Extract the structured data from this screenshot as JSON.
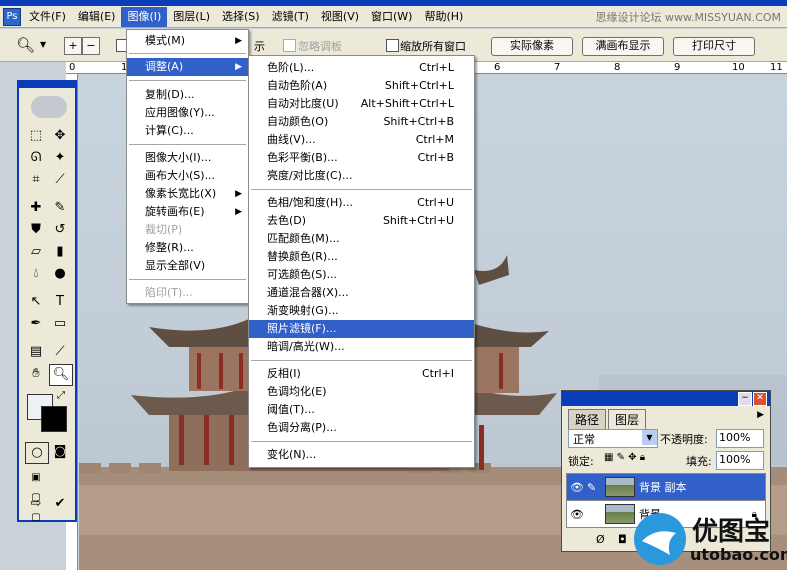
{
  "menubar": {
    "items": [
      "文件(F)",
      "编辑(E)",
      "图像(I)",
      "图层(L)",
      "选择(S)",
      "滤镜(T)",
      "视图(V)",
      "窗口(W)",
      "帮助(H)"
    ],
    "watermark": "思缘设计论坛 www.MISSYUAN.COM"
  },
  "options": {
    "ignore_palettes": "忽略调板",
    "resize_all_windows": "缩放所有窗口",
    "btn_actual_pixels": "实际像素",
    "btn_fit_screen": "满画布显示",
    "btn_print_size": "打印尺寸",
    "partial_label": "示"
  },
  "ruler": {
    "ticks": [
      "0",
      "1",
      "6",
      "7",
      "8",
      "9",
      "10",
      "11"
    ]
  },
  "image_menu": {
    "items": [
      {
        "label": "模式(M)",
        "submenu": true
      },
      {
        "label": "调整(A)",
        "submenu": true
      },
      {
        "label": "复制(D)..."
      },
      {
        "label": "应用图像(Y)..."
      },
      {
        "label": "计算(C)..."
      },
      {
        "label": "图像大小(I)..."
      },
      {
        "label": "画布大小(S)..."
      },
      {
        "label": "像素长宽比(X)",
        "submenu": true
      },
      {
        "label": "旋转画布(E)",
        "submenu": true
      },
      {
        "label": "裁切(P)",
        "disabled": true
      },
      {
        "label": "修整(R)..."
      },
      {
        "label": "显示全部(V)"
      },
      {
        "label": "陷印(T)...",
        "disabled": true
      }
    ]
  },
  "adjust_menu": {
    "items": [
      {
        "label": "色阶(L)...",
        "shortcut": "Ctrl+L"
      },
      {
        "label": "自动色阶(A)",
        "shortcut": "Shift+Ctrl+L"
      },
      {
        "label": "自动对比度(U)",
        "shortcut": "Alt+Shift+Ctrl+L"
      },
      {
        "label": "自动颜色(O)",
        "shortcut": "Shift+Ctrl+B"
      },
      {
        "label": "曲线(V)...",
        "shortcut": "Ctrl+M"
      },
      {
        "label": "色彩平衡(B)...",
        "shortcut": "Ctrl+B"
      },
      {
        "label": "亮度/对比度(C)..."
      },
      {
        "label": "色相/饱和度(H)...",
        "shortcut": "Ctrl+U"
      },
      {
        "label": "去色(D)",
        "shortcut": "Shift+Ctrl+U"
      },
      {
        "label": "匹配颜色(M)..."
      },
      {
        "label": "替换颜色(R)..."
      },
      {
        "label": "可选颜色(S)..."
      },
      {
        "label": "通道混合器(X)..."
      },
      {
        "label": "渐变映射(G)..."
      },
      {
        "label": "照片滤镜(F)..."
      },
      {
        "label": "暗调/高光(W)..."
      },
      {
        "label": "反相(I)",
        "shortcut": "Ctrl+I"
      },
      {
        "label": "色调均化(E)"
      },
      {
        "label": "阈值(T)..."
      },
      {
        "label": "色调分离(P)..."
      },
      {
        "label": "变化(N)..."
      }
    ]
  },
  "layers": {
    "tabs": [
      "路径",
      "图层"
    ],
    "blend_mode": "正常",
    "opacity_label": "不透明度:",
    "opacity_value": "100%",
    "lock_label": "锁定:",
    "fill_label": "填充:",
    "fill_value": "100%",
    "rows": [
      "背景 副本",
      "背景"
    ]
  },
  "logo": {
    "brand": "优图宝",
    "url": "utobao.com"
  },
  "colors": {
    "highlight": "#3161c8",
    "titlebar": "#0a3cba",
    "chrome": "#ece9d8"
  }
}
